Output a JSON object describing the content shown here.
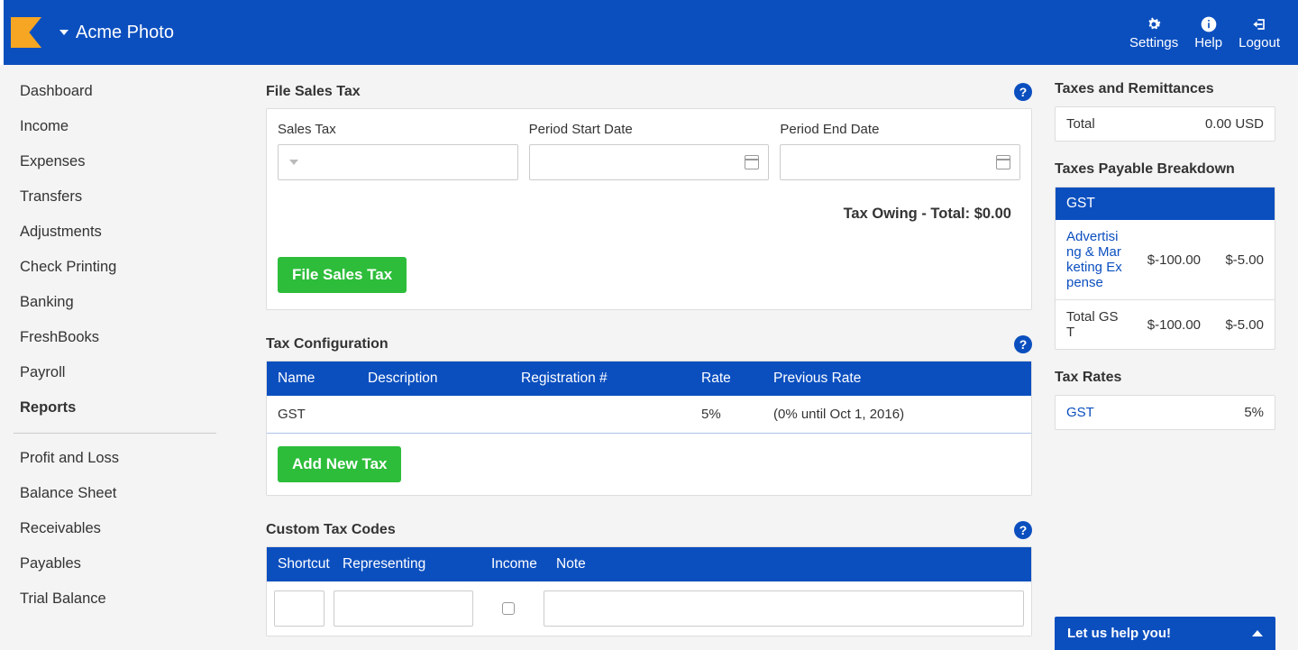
{
  "header": {
    "org_name": "Acme Photo",
    "settings_label": "Settings",
    "help_label": "Help",
    "logout_label": "Logout"
  },
  "sidebar": {
    "items": [
      "Dashboard",
      "Income",
      "Expenses",
      "Transfers",
      "Adjustments",
      "Check Printing",
      "Banking",
      "FreshBooks",
      "Payroll"
    ],
    "reports_header": "Reports",
    "report_items": [
      "Profit and Loss",
      "Balance Sheet",
      "Receivables",
      "Payables",
      "Trial Balance"
    ]
  },
  "file_sales_tax": {
    "title": "File Sales Tax",
    "sales_tax_label": "Sales Tax",
    "period_start_label": "Period Start Date",
    "period_end_label": "Period End Date",
    "tax_owing_text": "Tax Owing - Total: $0.00",
    "button_label": "File Sales Tax"
  },
  "tax_config": {
    "title": "Tax Configuration",
    "headers": {
      "name": "Name",
      "description": "Description",
      "registration": "Registration #",
      "rate": "Rate",
      "previous": "Previous Rate"
    },
    "rows": [
      {
        "name": "GST",
        "description": "",
        "registration": "",
        "rate": "5%",
        "previous": "(0% until Oct 1, 2016)"
      }
    ],
    "add_button_label": "Add New Tax"
  },
  "custom_tax_codes": {
    "title": "Custom Tax Codes",
    "headers": {
      "shortcut": "Shortcut",
      "representing": "Representing",
      "income": "Income",
      "note": "Note"
    }
  },
  "right": {
    "taxes_remittances_title": "Taxes and Remittances",
    "taxes_remittances_total_label": "Total",
    "taxes_remittances_total_value": "0.00 USD",
    "payable_breakdown_title": "Taxes Payable Breakdown",
    "payable_breakdown_tax": "GST",
    "payable_rows": [
      {
        "name": "Advertising & Marketing Expense",
        "amt1": "$-100.00",
        "amt2": "$-5.00"
      }
    ],
    "payable_total_label": "Total GST",
    "payable_total_amt1": "$-100.00",
    "payable_total_amt2": "$-5.00",
    "tax_rates_title": "Tax Rates",
    "tax_rates_rows": [
      {
        "name": "GST",
        "rate": "5%"
      }
    ]
  },
  "help_banner": "Let us help you!"
}
